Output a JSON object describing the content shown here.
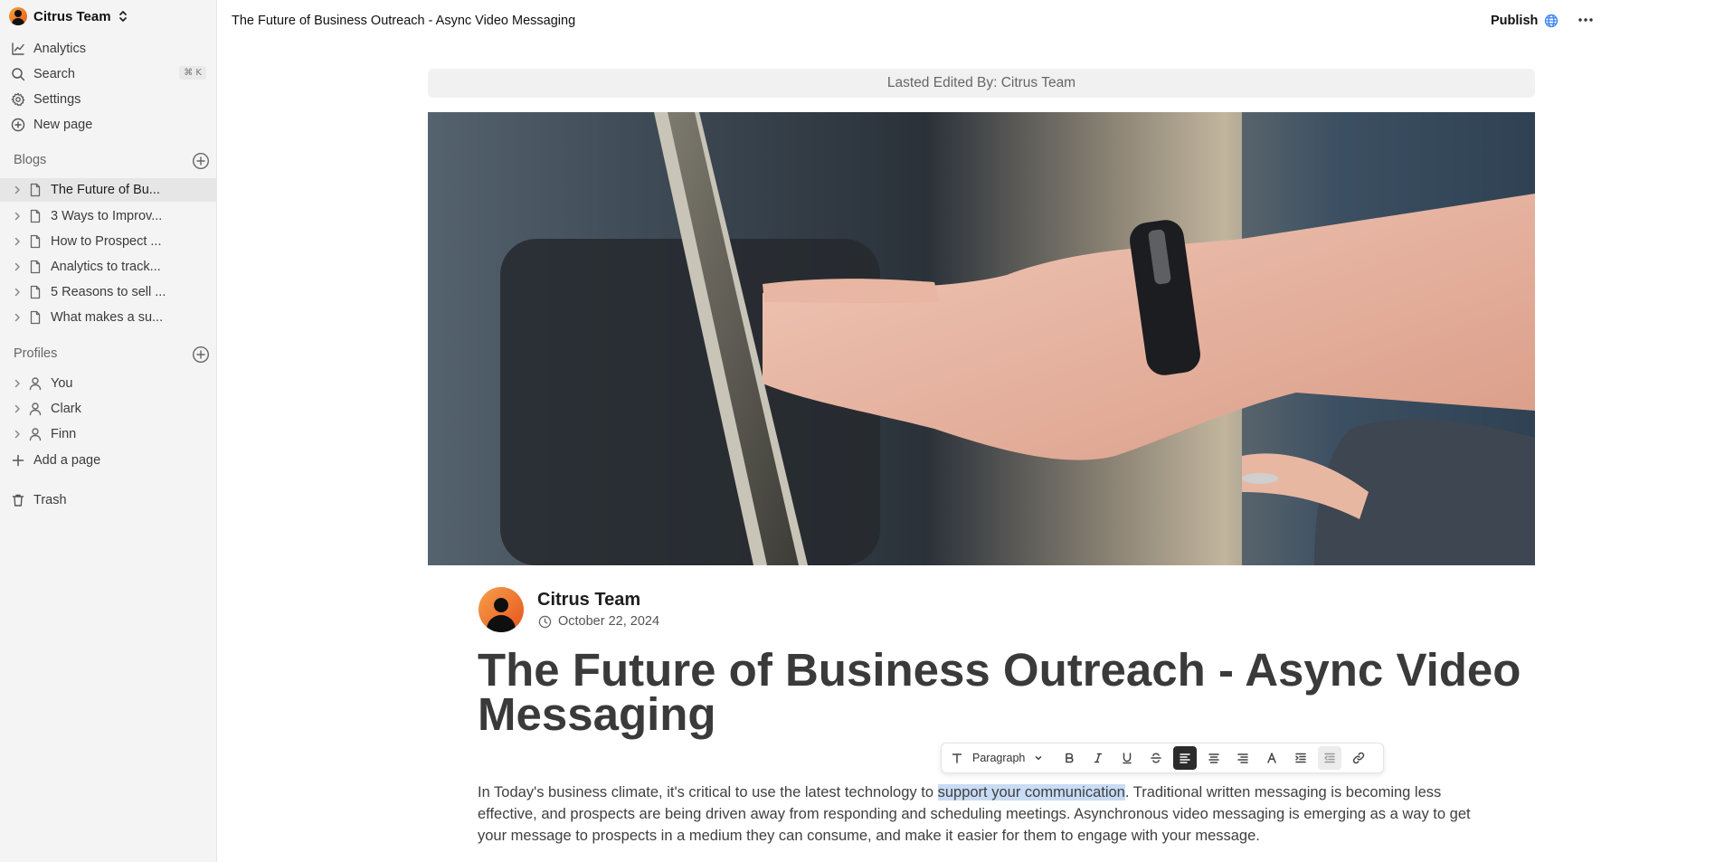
{
  "workspace": {
    "name": "Citrus Team"
  },
  "nav": {
    "analytics": "Analytics",
    "search": "Search",
    "search_shortcut": "⌘ K",
    "settings": "Settings",
    "new_page": "New page"
  },
  "blogs": {
    "heading": "Blogs",
    "items": [
      {
        "label": "The Future of Bu..."
      },
      {
        "label": "3 Ways to Improv..."
      },
      {
        "label": "How to Prospect ..."
      },
      {
        "label": "Analytics to track..."
      },
      {
        "label": "5 Reasons to sell ..."
      },
      {
        "label": "What makes a su..."
      }
    ]
  },
  "profiles": {
    "heading": "Profiles",
    "items": [
      {
        "label": "You"
      },
      {
        "label": "Clark"
      },
      {
        "label": "Finn"
      }
    ]
  },
  "add_page": "Add a page",
  "trash": "Trash",
  "header": {
    "title": "The Future of Business Outreach - Async Video Messaging",
    "publish": "Publish"
  },
  "main": {
    "last_edited": "Lasted Edited By: Citrus Team",
    "author": "Citrus Team",
    "date": "October 22, 2024",
    "title": "The Future of Business Outreach - Async Video Messaging",
    "toolbar": {
      "block_type": "Paragraph"
    },
    "paragraph": {
      "before": "In Today's business climate, it's critical to use the latest technology to ",
      "selected": "support your communication",
      "after": ". Traditional written messaging is becoming less effective, and prospects are being driven away from responding and scheduling meetings. Asynchronous video messaging is emerging as a way to get your message to prospects in a medium they can consume, and make it easier for them to engage with your message."
    }
  },
  "colors": {
    "sidebar_bg": "#f4f4f5",
    "selection": "#c9dcf5",
    "globe": "#3b82f6"
  }
}
